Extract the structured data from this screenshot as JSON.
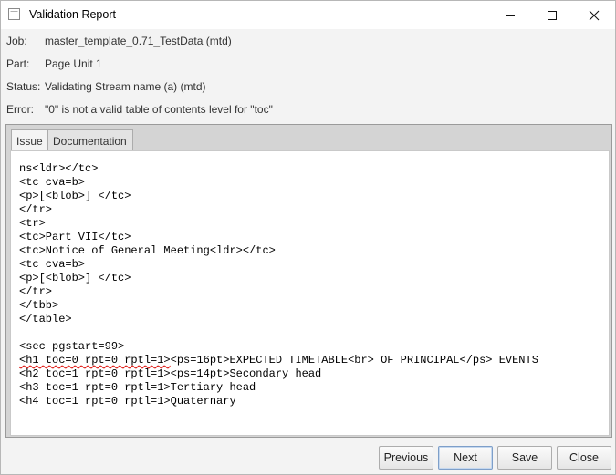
{
  "window": {
    "title": "Validation Report"
  },
  "info": {
    "job_label": "Job:",
    "job_value": "master_template_0.71_TestData (mtd)",
    "part_label": "Part:",
    "part_value": "Page Unit 1",
    "status_label": "Status:",
    "status_value": "Validating Stream name (a) (mtd)",
    "error_label": "Error:",
    "error_value": "\"0\" is not a valid table of contents level for \"toc\""
  },
  "tabs": [
    {
      "label": "Issue",
      "active": true
    },
    {
      "label": "Documentation",
      "active": false
    }
  ],
  "code": {
    "before": "ns<ldr></tc>\n<tc cva=b>\n<p>[<blob>] </tc>\n</tr>\n<tr>\n<tc>Part VII</tc>\n<tc>Notice of General Meeting<ldr></tc>\n<tc cva=b>\n<p>[<blob>] </tc>\n</tr>\n</tbb>\n</table>\n\n<sec pgstart=99>\n",
    "error_fragment": "<h1 toc=0 rpt=0 rptl=1>",
    "after": "<ps=16pt>EXPECTED TIMETABLE<br> OF PRINCIPAL</ps> EVENTS\n<h2 toc=1 rpt=0 rptl=1><ps=14pt>Secondary head\n<h3 toc=1 rpt=0 rptl=1>Tertiary head\n<h4 toc=1 rpt=0 rptl=1>Quaternary",
    "error_underline_color": "#e0201b"
  },
  "buttons": {
    "previous": "Previous",
    "next": "Next",
    "save": "Save",
    "close": "Close"
  },
  "icons": {
    "app": "app-icon",
    "minimize": "minimize-icon",
    "maximize": "maximize-icon",
    "close": "close-icon"
  }
}
